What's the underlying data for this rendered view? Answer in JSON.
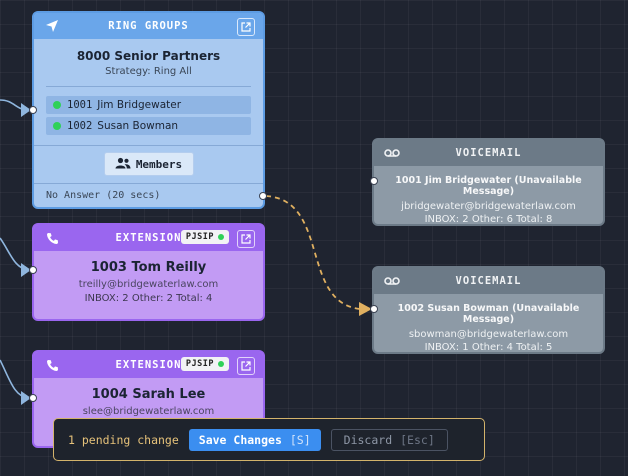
{
  "ring_group": {
    "header": "RING GROUPS",
    "title": "8000 Senior Partners",
    "strategy": "Strategy: Ring All",
    "members": [
      {
        "ext": "1001",
        "name": "Jim Bridgewater"
      },
      {
        "ext": "1002",
        "name": "Susan Bowman"
      }
    ],
    "members_button": "Members",
    "no_answer": "No Answer (20 secs)"
  },
  "extensions": [
    {
      "header": "EXTENSION",
      "badge": "PJSIP",
      "name": "1003 Tom Reilly",
      "email": "treilly@bridgewaterlaw.com",
      "inbox": "INBOX: 2 Other: 2 Total: 4"
    },
    {
      "header": "EXTENSION",
      "badge": "PJSIP",
      "name": "1004 Sarah Lee",
      "email": "slee@bridgewaterlaw.com"
    }
  ],
  "voicemails": [
    {
      "header": "VOICEMAIL",
      "title": "1001 Jim Bridgewater (Unavailable Message)",
      "email": "jbridgewater@bridgewaterlaw.com",
      "inbox": "INBOX: 2 Other: 6 Total: 8"
    },
    {
      "header": "VOICEMAIL",
      "title": "1002 Susan Bowman (Unavailable Message)",
      "email": "sbowman@bridgewaterlaw.com",
      "inbox": "INBOX: 1 Other: 4 Total: 5"
    }
  ],
  "pending_bar": {
    "text": "1 pending change",
    "save_label": "Save Changes",
    "save_key": "[S]",
    "discard_label": "Discard",
    "discard_key": "[Esc]"
  },
  "colors": {
    "ring_group": "#6aa6ea",
    "extension": "#9a66ef",
    "voicemail": "#6c7a87",
    "pending_edge": "#e0b060",
    "status_online": "#2fd158"
  }
}
